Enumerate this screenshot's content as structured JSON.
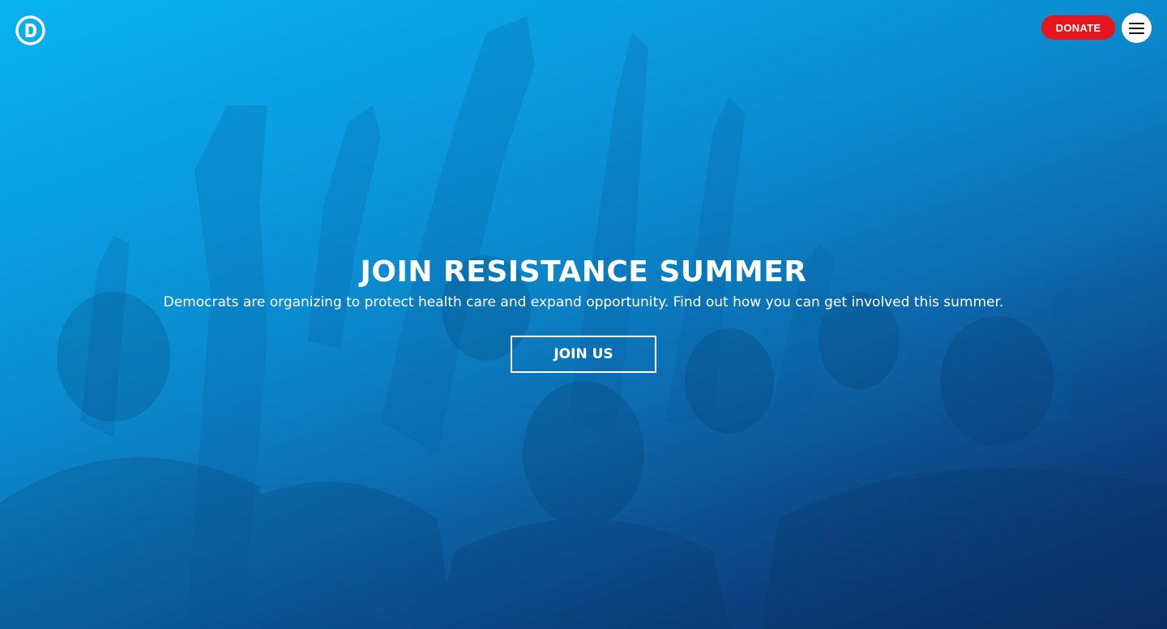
{
  "header": {
    "logo_letter": "D",
    "donate_label": "DONATE",
    "menu_icon": "hamburger-menu-icon"
  },
  "hero": {
    "headline": "JOIN RESISTANCE SUMMER",
    "subhead": "Democrats are organizing to protect health care and expand opportunity. Find out how you can get involved this summer.",
    "cta_label": "JOIN US"
  },
  "colors": {
    "donate_red": "#e5161d",
    "overlay_blue_light": "#08b1ee",
    "overlay_blue_dark": "#0b2e63"
  }
}
